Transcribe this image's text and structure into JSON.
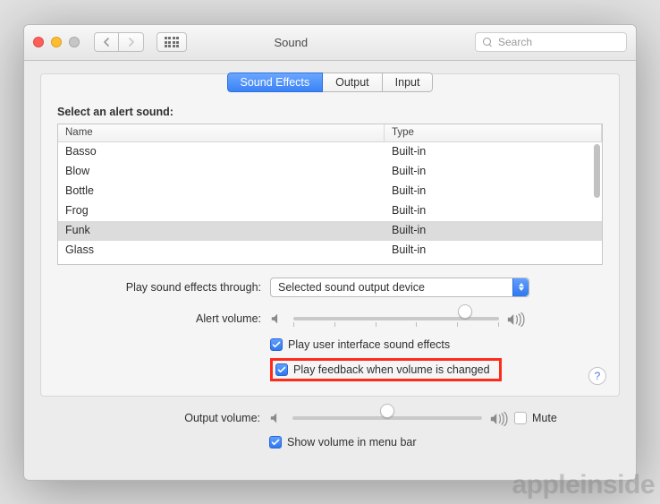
{
  "window": {
    "title": "Sound"
  },
  "toolbar": {
    "search_placeholder": "Search"
  },
  "tabs": {
    "effects": "Sound Effects",
    "output": "Output",
    "input": "Input",
    "active": "effects"
  },
  "section": {
    "select_alert": "Select an alert sound:"
  },
  "table": {
    "columns": {
      "name": "Name",
      "type": "Type"
    },
    "rows": [
      {
        "name": "Basso",
        "type": "Built-in"
      },
      {
        "name": "Blow",
        "type": "Built-in"
      },
      {
        "name": "Bottle",
        "type": "Built-in"
      },
      {
        "name": "Frog",
        "type": "Built-in"
      },
      {
        "name": "Funk",
        "type": "Built-in"
      },
      {
        "name": "Glass",
        "type": "Built-in"
      }
    ],
    "selected_index": 4
  },
  "labels": {
    "play_through": "Play sound effects through:",
    "alert_volume": "Alert volume:",
    "output_volume": "Output volume:"
  },
  "dropdown": {
    "play_through_value": "Selected sound output device"
  },
  "checkboxes": {
    "ui_sounds": "Play user interface sound effects",
    "volume_feedback": "Play feedback when volume is changed",
    "mute": "Mute",
    "menubar": "Show volume in menu bar"
  },
  "slider": {
    "alert_percent": 86,
    "output_percent": 50
  },
  "help": "?",
  "watermark": "appleinside"
}
